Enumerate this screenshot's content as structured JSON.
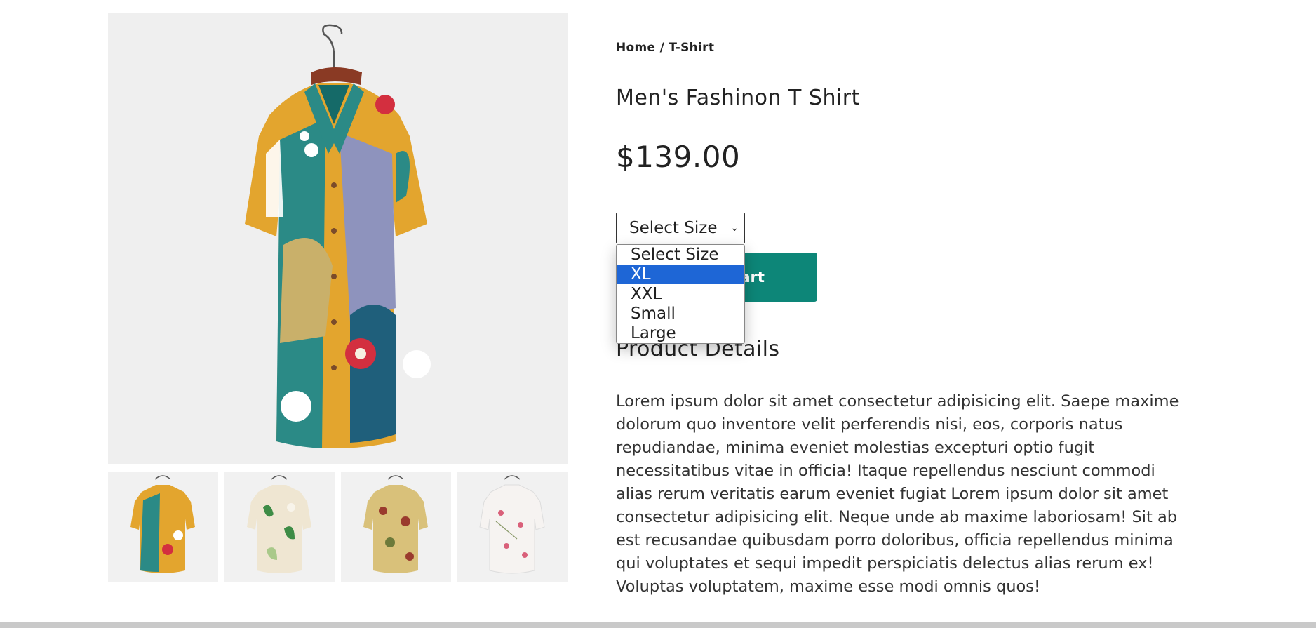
{
  "gallery": {
    "main_image": "patterned-shirt-image",
    "thumbnails": [
      {
        "name": "thumbnail-multicolor-shirt",
        "colors": [
          "#e3a52e",
          "#2b8a86",
          "#d32f3f"
        ]
      },
      {
        "name": "thumbnail-green-floral-shirt",
        "colors": [
          "#efe6d2",
          "#3e8c46",
          "#a9c98a"
        ]
      },
      {
        "name": "thumbnail-red-floral-shirt",
        "colors": [
          "#d9c17a",
          "#9a3b2e",
          "#6d7a3a"
        ]
      },
      {
        "name": "thumbnail-white-pink-shirt",
        "colors": [
          "#f6f3f1",
          "#d9607a",
          "#8a9a6a"
        ]
      }
    ]
  },
  "breadcrumb": {
    "home": "Home",
    "separator": "/",
    "current": "T-Shirt"
  },
  "product": {
    "title": "Men's Fashinon T Shirt",
    "price": "$139.00"
  },
  "size_select": {
    "value": "Select Size",
    "options": [
      "Select Size",
      "XL",
      "XXL",
      "Small",
      "Large"
    ],
    "highlighted": "XL"
  },
  "add_to_cart": {
    "label": "Add To Cart"
  },
  "details": {
    "heading": "Product Details",
    "text": "Lorem ipsum dolor sit amet consectetur adipisicing elit. Saepe maxime dolorum quo inventore velit perferendis nisi, eos, corporis natus repudiandae, minima eveniet molestias excepturi optio fugit necessitatibus vitae in officia! Itaque repellendus nesciunt commodi alias rerum veritatis earum eveniet fugiat Lorem ipsum dolor sit amet consectetur adipisicing elit. Neque unde ab maxime laboriosam! Sit ab est recusandae quibusdam porro doloribus, officia repellendus minima qui voluptates et sequi impedit perspiciatis delectus alias rerum ex! Voluptas voluptatem, maxime esse modi omnis quos!"
  },
  "colors": {
    "accent": "#0d8678",
    "dropdown_highlight": "#1e66d6"
  }
}
